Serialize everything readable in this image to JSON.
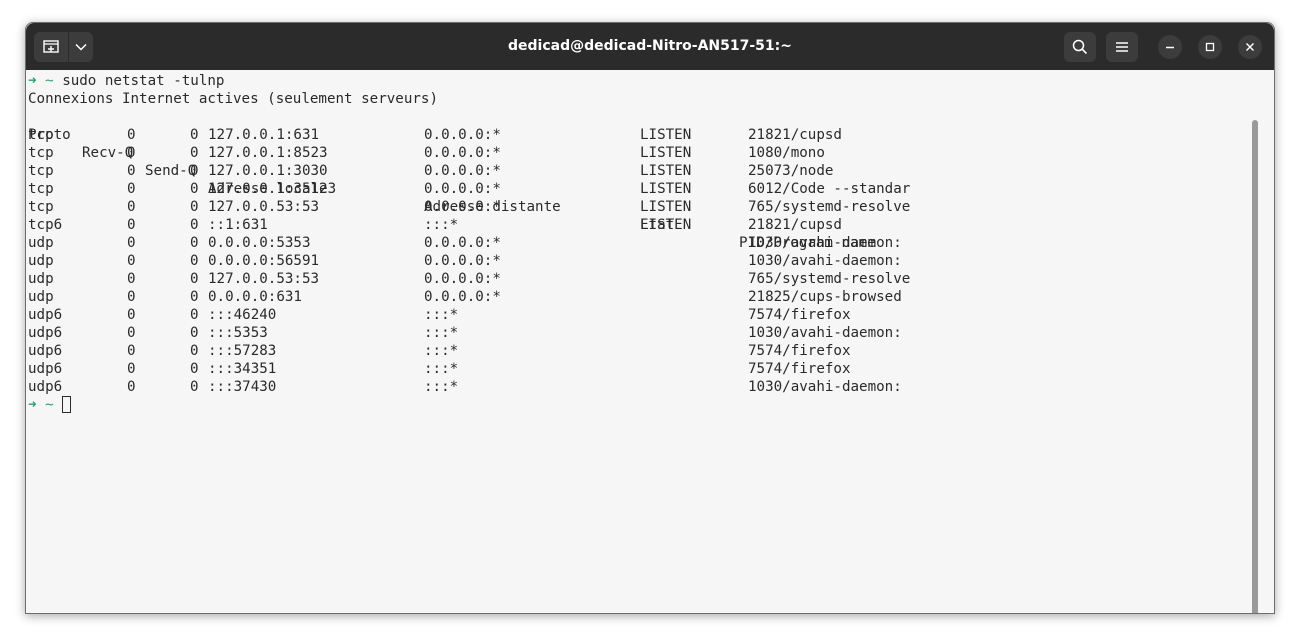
{
  "window": {
    "title": "dedicad@dedicad-Nitro-AN517-51:~"
  },
  "icons": {
    "new_tab": "new-tab-icon",
    "dropdown": "chevron-down-icon",
    "search": "search-icon",
    "menu": "hamburger-menu-icon",
    "minimize": "minimize-icon",
    "maximize": "maximize-icon",
    "close": "close-icon"
  },
  "colors": {
    "prompt": "#26a269",
    "titlebar": "#2b2b2b",
    "terminal_bg": "#f6f6f6",
    "text": "#2a2a2a"
  },
  "terminal": {
    "prompt_arrow": "➜",
    "prompt_dir": "~",
    "command": "sudo netstat -tulnp",
    "header_line": "Connexions Internet actives (seulement serveurs)",
    "columns": [
      "Proto",
      "Recv-Q",
      "Send-Q",
      "Adresse locale",
      "Adresse distante",
      "Etat",
      "PID/Program name"
    ],
    "rows": [
      {
        "proto": "tcp",
        "recvq": "0",
        "sendq": "0",
        "local": "127.0.0.1:631",
        "remote": "0.0.0.0:*",
        "state": "LISTEN",
        "pid": "21821/cupsd"
      },
      {
        "proto": "tcp",
        "recvq": "0",
        "sendq": "0",
        "local": "127.0.0.1:8523",
        "remote": "0.0.0.0:*",
        "state": "LISTEN",
        "pid": "1080/mono"
      },
      {
        "proto": "tcp",
        "recvq": "0",
        "sendq": "0",
        "local": "127.0.0.1:3030",
        "remote": "0.0.0.0:*",
        "state": "LISTEN",
        "pid": "25073/node"
      },
      {
        "proto": "tcp",
        "recvq": "0",
        "sendq": "0",
        "local": "127.0.0.1:35123",
        "remote": "0.0.0.0:*",
        "state": "LISTEN",
        "pid": "6012/Code --standar"
      },
      {
        "proto": "tcp",
        "recvq": "0",
        "sendq": "0",
        "local": "127.0.0.53:53",
        "remote": "0.0.0.0:*",
        "state": "LISTEN",
        "pid": "765/systemd-resolve"
      },
      {
        "proto": "tcp6",
        "recvq": "0",
        "sendq": "0",
        "local": "::1:631",
        "remote": ":::*",
        "state": "LISTEN",
        "pid": "21821/cupsd"
      },
      {
        "proto": "udp",
        "recvq": "0",
        "sendq": "0",
        "local": "0.0.0.0:5353",
        "remote": "0.0.0.0:*",
        "state": "",
        "pid": "1030/avahi-daemon:"
      },
      {
        "proto": "udp",
        "recvq": "0",
        "sendq": "0",
        "local": "0.0.0.0:56591",
        "remote": "0.0.0.0:*",
        "state": "",
        "pid": "1030/avahi-daemon:"
      },
      {
        "proto": "udp",
        "recvq": "0",
        "sendq": "0",
        "local": "127.0.0.53:53",
        "remote": "0.0.0.0:*",
        "state": "",
        "pid": "765/systemd-resolve"
      },
      {
        "proto": "udp",
        "recvq": "0",
        "sendq": "0",
        "local": "0.0.0.0:631",
        "remote": "0.0.0.0:*",
        "state": "",
        "pid": "21825/cups-browsed"
      },
      {
        "proto": "udp6",
        "recvq": "0",
        "sendq": "0",
        "local": ":::46240",
        "remote": ":::*",
        "state": "",
        "pid": "7574/firefox"
      },
      {
        "proto": "udp6",
        "recvq": "0",
        "sendq": "0",
        "local": ":::5353",
        "remote": ":::*",
        "state": "",
        "pid": "1030/avahi-daemon:"
      },
      {
        "proto": "udp6",
        "recvq": "0",
        "sendq": "0",
        "local": ":::57283",
        "remote": ":::*",
        "state": "",
        "pid": "7574/firefox"
      },
      {
        "proto": "udp6",
        "recvq": "0",
        "sendq": "0",
        "local": ":::34351",
        "remote": ":::*",
        "state": "",
        "pid": "7574/firefox"
      },
      {
        "proto": "udp6",
        "recvq": "0",
        "sendq": "0",
        "local": ":::37430",
        "remote": ":::*",
        "state": "",
        "pid": "1030/avahi-daemon:"
      }
    ]
  }
}
